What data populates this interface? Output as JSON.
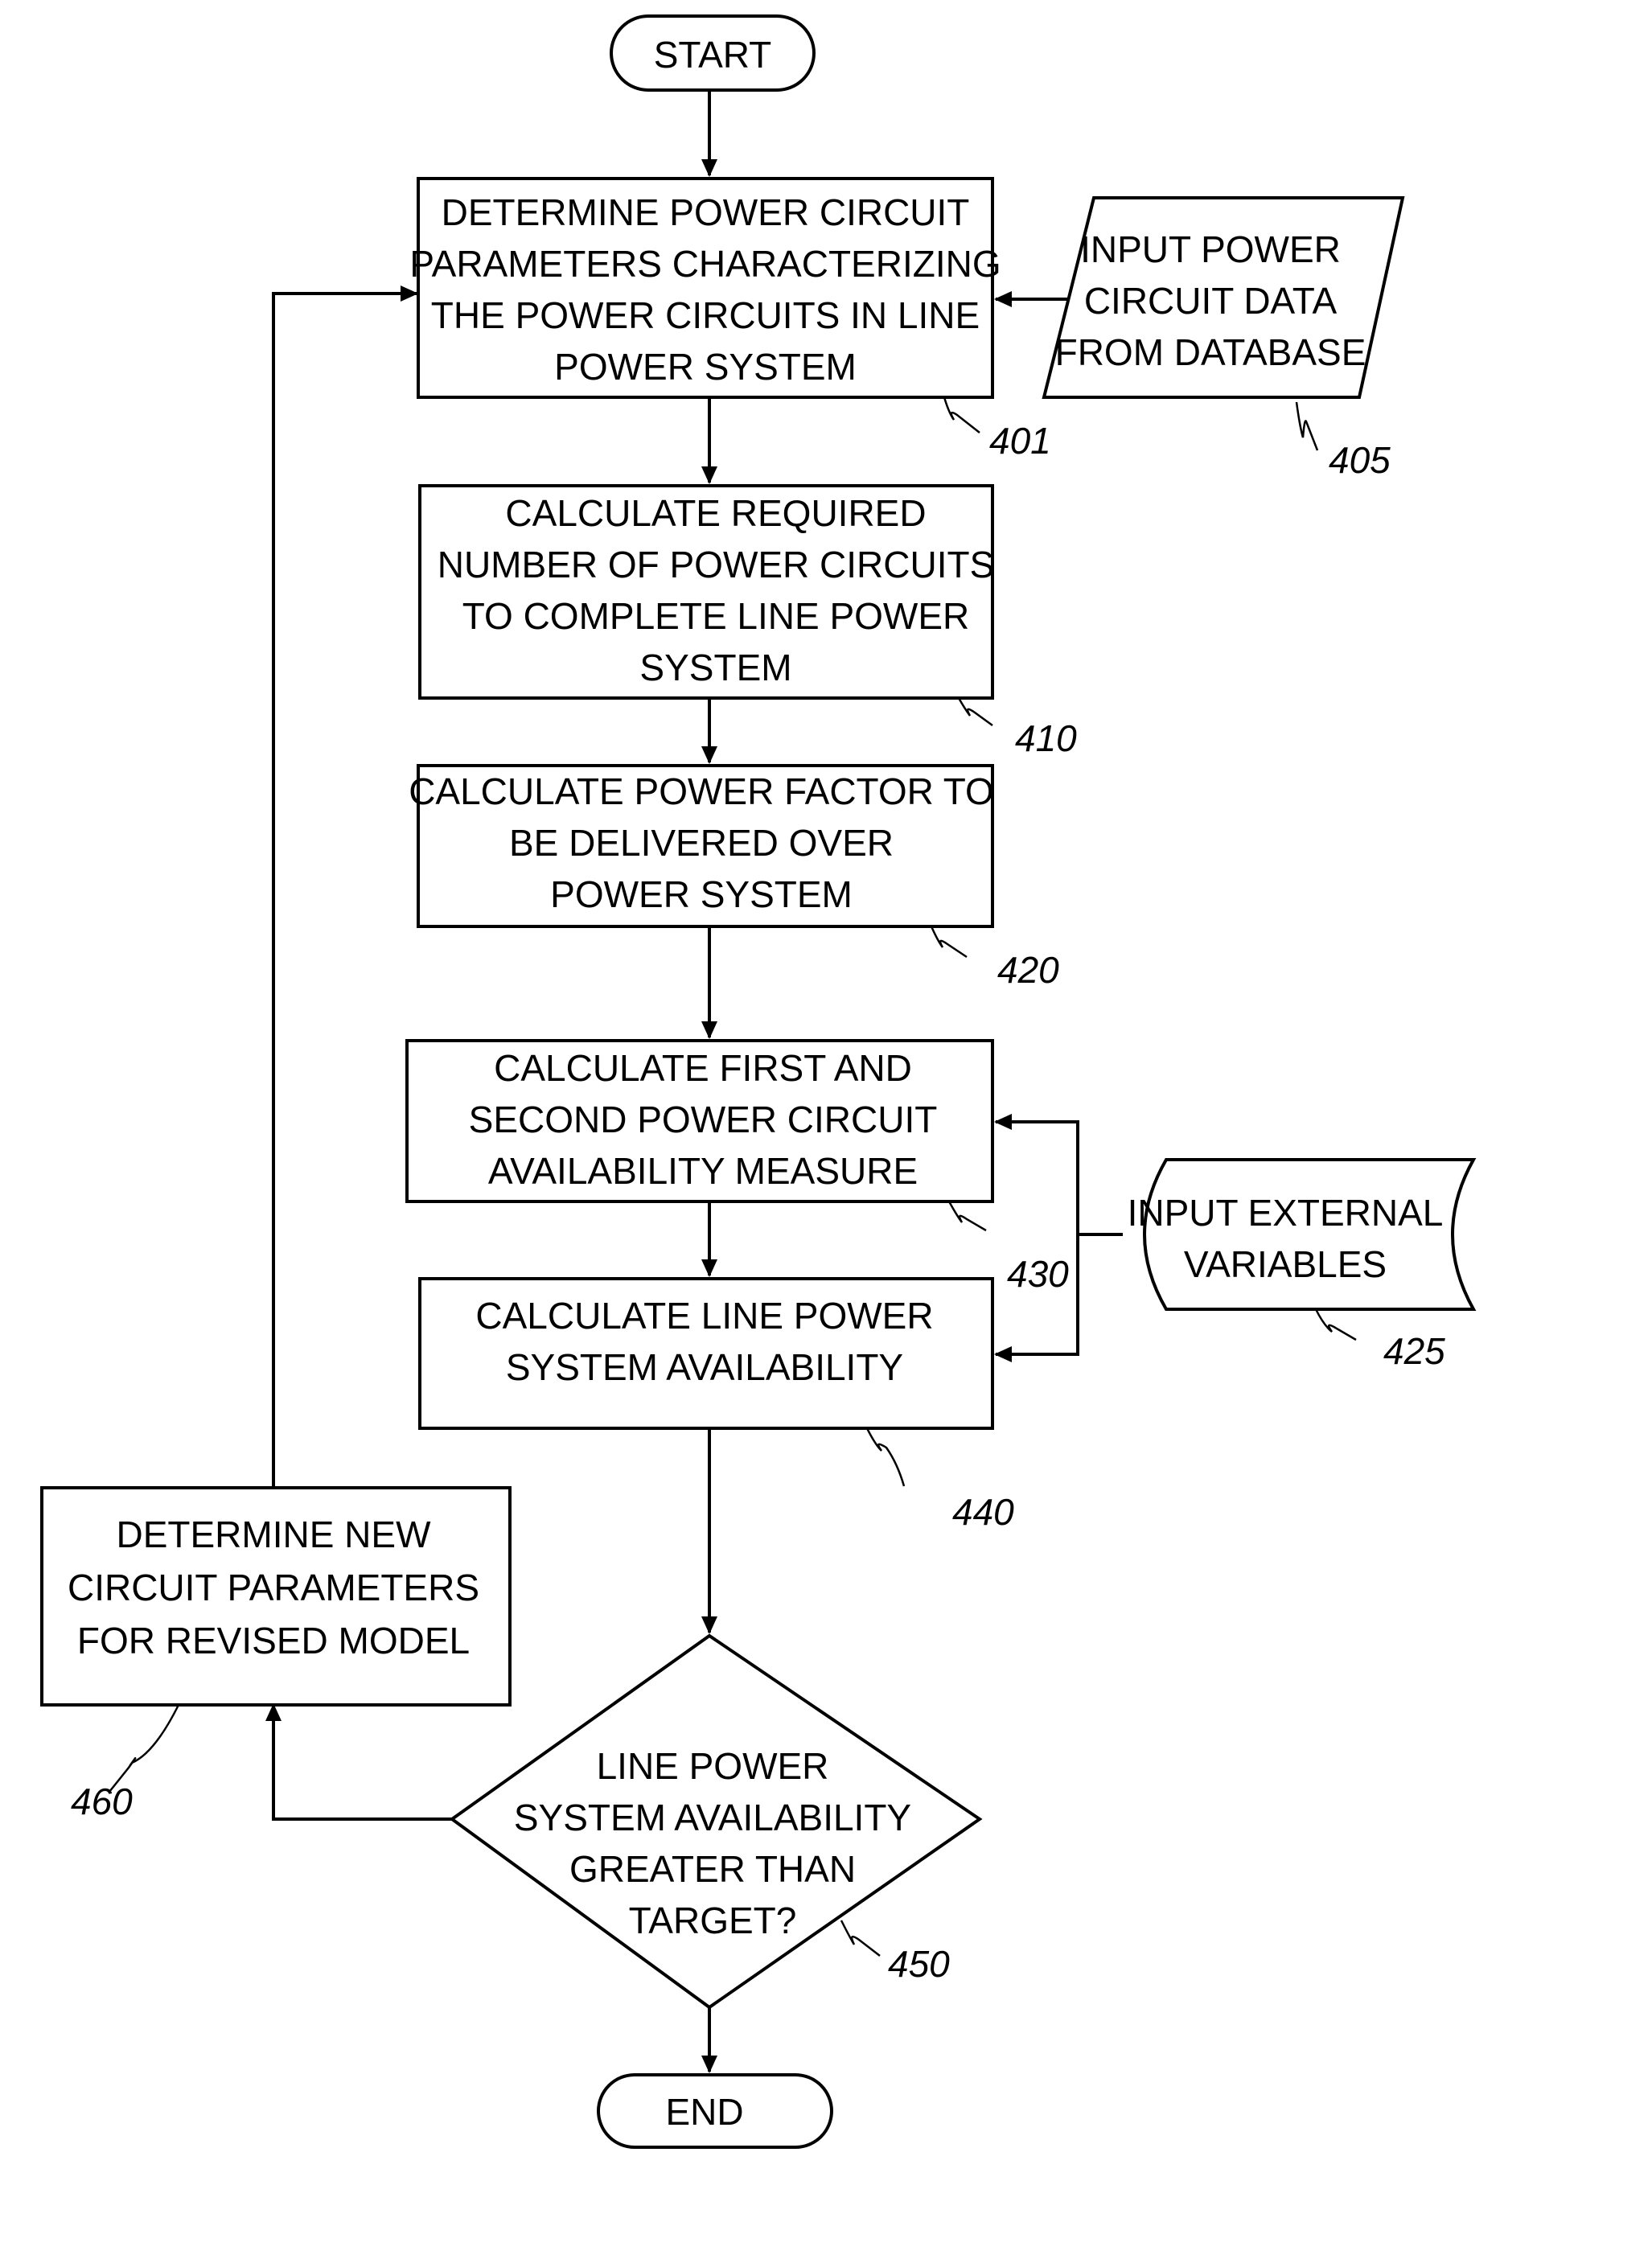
{
  "diagram": {
    "type": "flowchart",
    "nodes": [
      {
        "id": "start",
        "shape": "terminator",
        "lines": [
          "START"
        ],
        "ref": ""
      },
      {
        "id": "401",
        "shape": "process",
        "lines": [
          "DETERMINE POWER CIRCUIT",
          "PARAMETERS CHARACTERIZING",
          "THE POWER CIRCUITS IN LINE",
          "POWER SYSTEM"
        ],
        "ref": "401"
      },
      {
        "id": "405",
        "shape": "data-input",
        "lines": [
          "INPUT POWER",
          "CIRCUIT DATA",
          "FROM DATABASE"
        ],
        "ref": "405"
      },
      {
        "id": "410",
        "shape": "process",
        "lines": [
          "CALCULATE REQUIRED",
          "NUMBER OF POWER CIRCUITS",
          "TO COMPLETE LINE POWER",
          "SYSTEM"
        ],
        "ref": "410"
      },
      {
        "id": "420",
        "shape": "process",
        "lines": [
          "CALCULATE POWER FACTOR TO",
          "BE DELIVERED OVER",
          "POWER SYSTEM"
        ],
        "ref": "420"
      },
      {
        "id": "430",
        "shape": "process",
        "lines": [
          "CALCULATE FIRST AND",
          "SECOND POWER CIRCUIT",
          "AVAILABILITY MEASURE"
        ],
        "ref": "430"
      },
      {
        "id": "425",
        "shape": "stored-data",
        "lines": [
          "INPUT EXTERNAL",
          "VARIABLES"
        ],
        "ref": "425"
      },
      {
        "id": "440",
        "shape": "process",
        "lines": [
          "CALCULATE LINE POWER",
          "SYSTEM AVAILABILITY"
        ],
        "ref": "440"
      },
      {
        "id": "450",
        "shape": "decision",
        "lines": [
          "LINE POWER",
          "SYSTEM AVAILABILITY",
          "GREATER THAN",
          "TARGET?"
        ],
        "ref": "450"
      },
      {
        "id": "460",
        "shape": "process",
        "lines": [
          "DETERMINE NEW",
          "CIRCUIT PARAMETERS",
          "FOR REVISED MODEL"
        ],
        "ref": "460"
      },
      {
        "id": "end",
        "shape": "terminator",
        "lines": [
          "END"
        ],
        "ref": ""
      }
    ],
    "edges": [
      {
        "from": "start",
        "to": "401"
      },
      {
        "from": "405",
        "to": "401"
      },
      {
        "from": "401",
        "to": "410"
      },
      {
        "from": "410",
        "to": "420"
      },
      {
        "from": "420",
        "to": "430"
      },
      {
        "from": "425",
        "to": "430"
      },
      {
        "from": "430",
        "to": "440"
      },
      {
        "from": "425",
        "to": "440"
      },
      {
        "from": "440",
        "to": "450"
      },
      {
        "from": "450",
        "to": "end"
      },
      {
        "from": "450",
        "to": "460"
      },
      {
        "from": "460",
        "to": "401"
      }
    ]
  }
}
